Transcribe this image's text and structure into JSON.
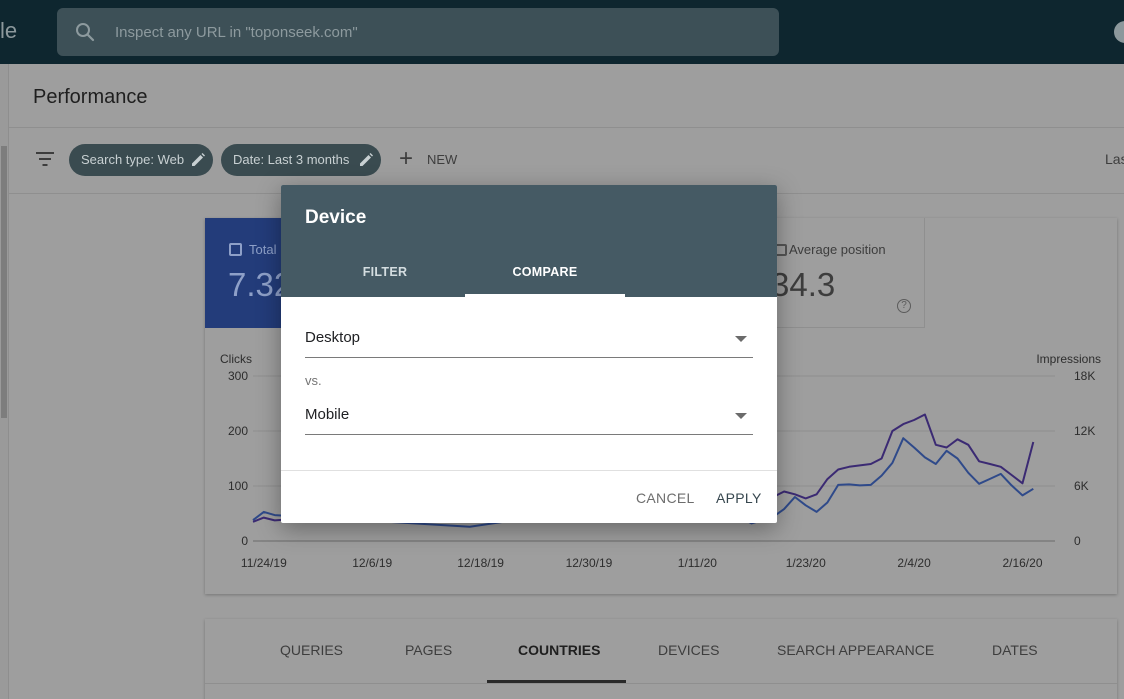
{
  "top_bar": {
    "logo_fragment": "le",
    "search_placeholder": "Inspect any URL in \"toponseek.com\""
  },
  "header": {
    "title": "Performance"
  },
  "filters": {
    "chips": [
      "Search type: Web",
      "Date: Last 3 months"
    ],
    "new_label": "NEW",
    "last_updated_fragment": "Las"
  },
  "metrics": {
    "clicks": {
      "label": "Total",
      "value": "7.32"
    },
    "position": {
      "label": "Average position",
      "value": "34.3",
      "help": "?"
    }
  },
  "chart_data": {
    "type": "line",
    "y_left_label": "Clicks",
    "y_right_label": "Impressions",
    "y_left_ticks": [
      "0",
      "100",
      "200",
      "300"
    ],
    "y_right_ticks": [
      "0",
      "6K",
      "12K",
      "18K"
    ],
    "y_left_range": [
      0,
      300
    ],
    "y_right_range": [
      0,
      18000
    ],
    "x_tick_labels": [
      "11/24/19",
      "12/6/19",
      "12/18/19",
      "12/30/19",
      "1/11/20",
      "1/23/20",
      "2/4/20",
      "2/16/20"
    ],
    "grid": true,
    "series": [
      {
        "color": "#2f4a8a",
        "axis": "left",
        "points": [
          [
            0,
            38
          ],
          [
            1,
            53
          ],
          [
            2,
            47
          ],
          [
            20,
            26
          ],
          [
            39,
            80
          ],
          [
            40,
            72
          ],
          [
            41,
            66
          ],
          [
            42,
            57
          ],
          [
            43,
            40
          ],
          [
            44,
            36
          ],
          [
            45,
            42
          ],
          [
            46,
            32
          ],
          [
            47,
            38
          ],
          [
            48,
            44
          ],
          [
            49,
            58
          ],
          [
            50,
            80
          ],
          [
            51,
            65
          ],
          [
            52,
            53
          ],
          [
            53,
            70
          ],
          [
            54,
            102
          ],
          [
            55,
            103
          ],
          [
            56,
            101
          ],
          [
            57,
            102
          ],
          [
            58,
            119
          ],
          [
            59,
            142
          ],
          [
            60,
            187
          ],
          [
            61,
            170
          ],
          [
            62,
            152
          ],
          [
            63,
            140
          ],
          [
            64,
            164
          ],
          [
            65,
            150
          ],
          [
            66,
            124
          ],
          [
            67,
            104
          ],
          [
            68,
            113
          ],
          [
            69,
            122
          ],
          [
            70,
            101
          ],
          [
            71,
            83
          ],
          [
            72,
            95
          ]
        ]
      },
      {
        "color": "#3b2a73",
        "axis": "right",
        "points": [
          [
            0,
            2100
          ],
          [
            1,
            2550
          ],
          [
            2,
            2250
          ],
          [
            39,
            5400
          ],
          [
            40,
            4950
          ],
          [
            41,
            4500
          ],
          [
            42,
            4050
          ],
          [
            43,
            3750
          ],
          [
            44,
            3200
          ],
          [
            45,
            3450
          ],
          [
            46,
            3750
          ],
          [
            47,
            4050
          ],
          [
            48,
            4800
          ],
          [
            49,
            5400
          ],
          [
            50,
            5100
          ],
          [
            51,
            4650
          ],
          [
            52,
            5100
          ],
          [
            53,
            6750
          ],
          [
            54,
            7800
          ],
          [
            55,
            8100
          ],
          [
            56,
            8250
          ],
          [
            57,
            8400
          ],
          [
            58,
            9000
          ],
          [
            59,
            12000
          ],
          [
            60,
            12750
          ],
          [
            61,
            13200
          ],
          [
            62,
            13800
          ],
          [
            63,
            10500
          ],
          [
            64,
            10200
          ],
          [
            65,
            11100
          ],
          [
            66,
            10500
          ],
          [
            67,
            8700
          ],
          [
            68,
            8400
          ],
          [
            69,
            8100
          ],
          [
            70,
            7200
          ],
          [
            71,
            6300
          ],
          [
            72,
            10800
          ]
        ]
      }
    ]
  },
  "dialog": {
    "title": "Device",
    "tabs": [
      "FILTER",
      "COMPARE"
    ],
    "active_tab": "COMPARE",
    "first_value": "Desktop",
    "vs_label": "vs.",
    "second_value": "Mobile",
    "cancel_label": "CANCEL",
    "apply_label": "APPLY"
  },
  "bottom_tabs": {
    "items": [
      "QUERIES",
      "PAGES",
      "COUNTRIES",
      "DEVICES",
      "SEARCH APPEARANCE",
      "DATES"
    ],
    "active": "COUNTRIES"
  }
}
